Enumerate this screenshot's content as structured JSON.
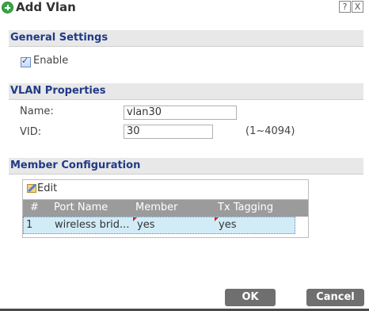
{
  "window": {
    "title": "Add Vlan",
    "help_label": "?",
    "close_label": "X"
  },
  "general": {
    "title": "General Settings",
    "enable_label": "Enable",
    "enable_checked": true
  },
  "vlan": {
    "title": "VLAN Properties",
    "name_label": "Name:",
    "name_value": "vlan30",
    "vid_label": "VID:",
    "vid_value": "30",
    "vid_range": "(1~4094)"
  },
  "member": {
    "title": "Member Configuration",
    "edit_label": "Edit",
    "columns": [
      "#",
      "Port Name",
      "Member",
      "Tx Tagging"
    ],
    "rows": [
      {
        "index": "1",
        "port_name": "wireless brid...",
        "member": "yes",
        "tx_tagging": "yes"
      }
    ]
  },
  "footer": {
    "ok_label": "OK",
    "cancel_label": "Cancel"
  },
  "colors": {
    "section_title": "#1f3a87",
    "header_bg": "#9b9b9b",
    "selected_row": "#d2ecf7",
    "button_bg": "#6f6f6f"
  }
}
